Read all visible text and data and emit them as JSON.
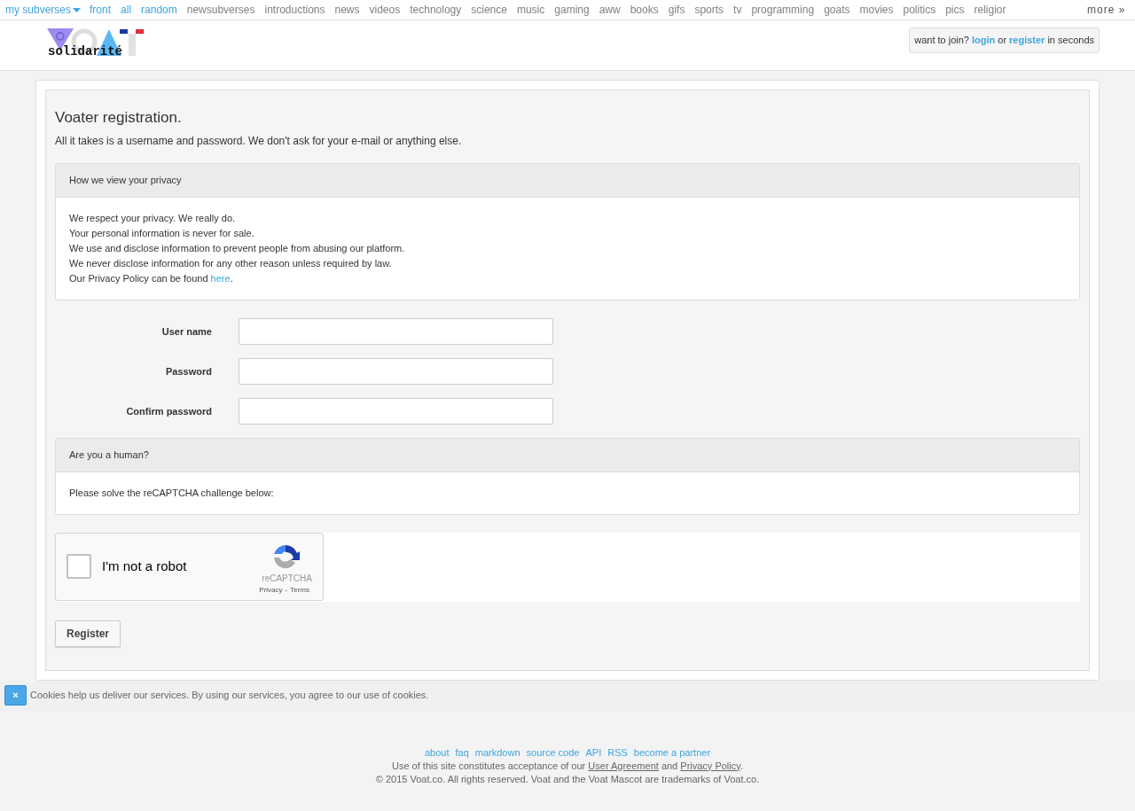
{
  "top_nav": {
    "dropdown": "my subverses",
    "items": [
      {
        "label": "front",
        "kind": "main"
      },
      {
        "label": "all",
        "kind": "main"
      },
      {
        "label": "random",
        "kind": "main"
      },
      {
        "label": "newsubverses",
        "kind": "sub"
      },
      {
        "label": "introductions",
        "kind": "sub"
      },
      {
        "label": "news",
        "kind": "sub"
      },
      {
        "label": "videos",
        "kind": "sub"
      },
      {
        "label": "technology",
        "kind": "sub"
      },
      {
        "label": "science",
        "kind": "sub"
      },
      {
        "label": "music",
        "kind": "sub"
      },
      {
        "label": "gaming",
        "kind": "sub"
      },
      {
        "label": "aww",
        "kind": "sub"
      },
      {
        "label": "books",
        "kind": "sub"
      },
      {
        "label": "gifs",
        "kind": "sub"
      },
      {
        "label": "sports",
        "kind": "sub"
      },
      {
        "label": "tv",
        "kind": "sub"
      },
      {
        "label": "programming",
        "kind": "sub"
      },
      {
        "label": "goats",
        "kind": "sub"
      },
      {
        "label": "movies",
        "kind": "sub"
      },
      {
        "label": "politics",
        "kind": "sub"
      },
      {
        "label": "pics",
        "kind": "sub"
      },
      {
        "label": "religior",
        "kind": "sub"
      }
    ],
    "more": "more »"
  },
  "header": {
    "logo_text": "solidarité",
    "join": {
      "prefix": "want to join?",
      "login": "login",
      "middle": "or",
      "register": "register",
      "suffix": "in seconds"
    }
  },
  "form": {
    "title": "Voater registration.",
    "intro": "All it takes is a username and password. We don't ask for your e-mail or anything else.",
    "privacy_panel": {
      "heading": "How we view your privacy",
      "lines": [
        "We respect your privacy. We really do.",
        "Your personal information is never for sale.",
        "We use and disclose information to prevent people from abusing our platform.",
        "We never disclose information for any other reason unless required by law."
      ],
      "last_line": {
        "prefix": "Our Privacy Policy can be found",
        "link": "here",
        "suffix": "."
      }
    },
    "fields": [
      {
        "label": "User name"
      },
      {
        "label": "Password"
      },
      {
        "label": "Confirm password"
      }
    ],
    "human_panel": {
      "heading": "Are you a human?",
      "text": "Please solve the reCAPTCHA challenge below:"
    },
    "captcha": {
      "label": "I'm not a robot",
      "checked": false,
      "brand": "reCAPTCHA",
      "privacy": "Privacy",
      "separator": "-",
      "terms": "Terms"
    },
    "submit": "Register"
  },
  "cookie_bar": {
    "close": "×",
    "text": "Cookies help us deliver our services. By using our services, you agree to our use of cookies."
  },
  "footer": {
    "links": [
      "about",
      "faq",
      "markdown",
      "source code",
      "API",
      "RSS",
      "become a partner"
    ],
    "terms": {
      "prefix": "Use of this site constitutes acceptance of our",
      "agreement": "User Agreement",
      "middle": "and",
      "policy": "Privacy Policy",
      "suffix": "."
    },
    "copyright": "© 2015 Voat.co. All rights reserved. Voat and the Voat Mascot are trademarks of Voat.co."
  }
}
